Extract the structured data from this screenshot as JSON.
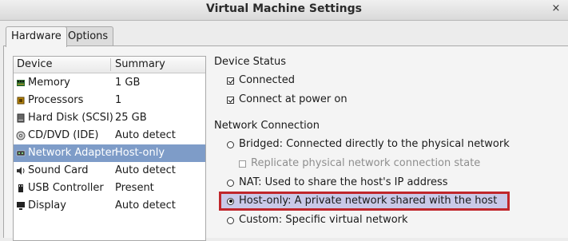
{
  "window": {
    "title": "Virtual Machine Settings",
    "close_glyph": "×"
  },
  "tabs": [
    {
      "label": "Hardware",
      "active": true
    },
    {
      "label": "Options",
      "active": false
    }
  ],
  "device_list": {
    "headers": {
      "device": "Device",
      "summary": "Summary"
    },
    "rows": [
      {
        "device": "Memory",
        "summary": "1 GB",
        "icon": "memory-icon"
      },
      {
        "device": "Processors",
        "summary": "1",
        "icon": "processor-icon"
      },
      {
        "device": "Hard Disk (SCSI)",
        "summary": "25 GB",
        "icon": "hard-disk-icon"
      },
      {
        "device": "CD/DVD (IDE)",
        "summary": "Auto detect",
        "icon": "cd-dvd-icon"
      },
      {
        "device": "Network Adapter",
        "summary": "Host-only",
        "icon": "network-adapter-icon",
        "selected": true
      },
      {
        "device": "Sound Card",
        "summary": "Auto detect",
        "icon": "sound-card-icon"
      },
      {
        "device": "USB Controller",
        "summary": "Present",
        "icon": "usb-icon"
      },
      {
        "device": "Display",
        "summary": "Auto detect",
        "icon": "display-icon"
      }
    ]
  },
  "device_status": {
    "title": "Device Status",
    "connected": {
      "label": "Connected",
      "checked": true
    },
    "connect_at_power_on": {
      "label": "Connect at power on",
      "checked": true
    }
  },
  "network_connection": {
    "title": "Network Connection",
    "bridged": {
      "label": "Bridged: Connected directly to the physical network",
      "selected": false
    },
    "replicate": {
      "label": "Replicate physical network connection state",
      "checked": false,
      "disabled": true
    },
    "nat": {
      "label": "NAT: Used to share the host's IP address",
      "selected": false
    },
    "host_only": {
      "label": "Host-only: A private network shared with the host",
      "selected": true
    },
    "custom": {
      "label": "Custom: Specific virtual network",
      "selected": false
    }
  },
  "colors": {
    "selection": "#7e9cc8",
    "highlight_border": "#c0262b",
    "highlight_fill": "#c9c9e8"
  }
}
